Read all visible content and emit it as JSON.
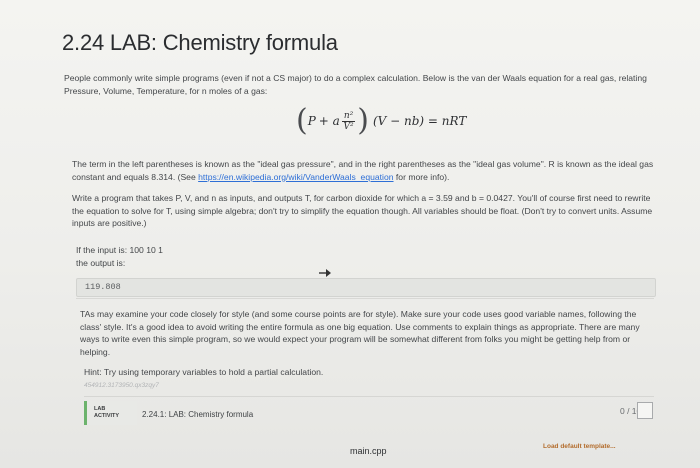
{
  "page": {
    "title": "2.24 LAB: Chemistry formula",
    "intro": "People commonly write simple programs (even if not a CS major) to do a complex calculation. Below is the van der Waals equation for a real gas, relating Pressure, Volume, Temperature, for n moles of a gas:",
    "formula": {
      "P": "P",
      "a": "+ a",
      "num": "n²",
      "den": "V²",
      "rest": "(V − nb) = nRT"
    },
    "explain_before_link": "The term in the left parentheses is known as the \"ideal gas pressure\", and in the right parentheses as the \"ideal gas volume\". R is known as the ideal gas constant and equals 8.314. (See ",
    "link_text": "https://en.wikipedia.org/wiki/VanderWaals_equation",
    "explain_after_link": " for more info).",
    "task": "Write a program that takes P, V, and n as inputs, and outputs T, for carbon dioxide for which a = 3.59 and b = 0.0427. You'll of course first need to rewrite the equation to solve for T, using simple algebra; don't try to simplify the equation though. All variables should be float. (Don't try to convert units. Assume inputs are positive.)",
    "example_input_label": "If the input is: 100 10 1",
    "example_output_label": "the output is:",
    "example_output": "119.808",
    "style_note": "TAs may examine your code closely for style (and some course points are for style). Make sure your code uses good variable names, following the class' style. It's a good idea to avoid writing the entire formula as one big equation. Use comments to explain things as appropriate. There are many ways to write even this simple program, so we would expect your program will be somewhat different from folks you might be getting help from or helping.",
    "hint": "Hint: Try using temporary variables to hold a partial calculation.",
    "faint_id": "454912.3173950.qx3zqy7"
  },
  "lab": {
    "badge_line1": "LAB",
    "badge_line2": "ACTIVITY",
    "name": "2.24.1: LAB: Chemistry formula",
    "score": "0 / 10"
  },
  "editor": {
    "file_name": "main.cpp",
    "load_template": "Load default template..."
  }
}
